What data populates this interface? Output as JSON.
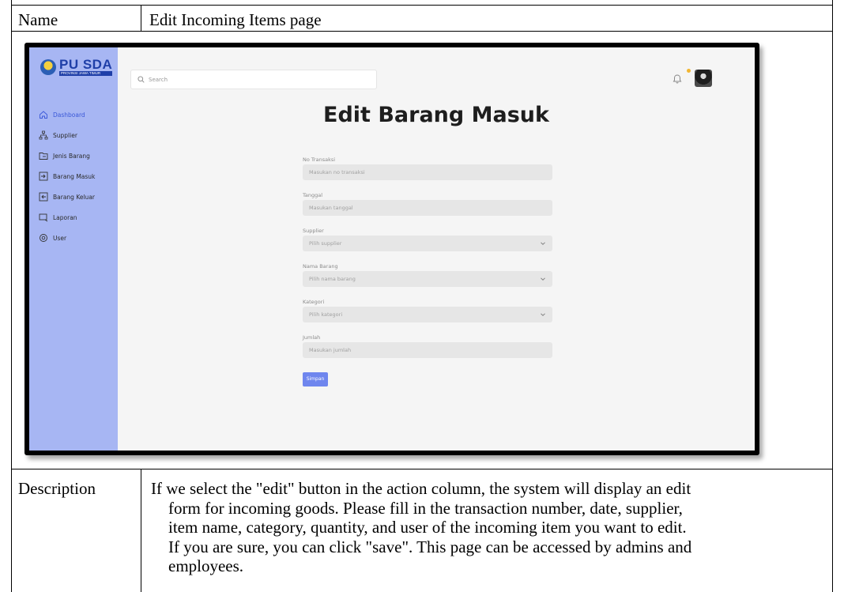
{
  "doc": {
    "name_label": "Name",
    "name_value": "Edit Incoming Items page",
    "description_label": "Description",
    "description_lines": [
      "If we select the \"edit\" button in the action column, the system will display an edit",
      "form for incoming goods. Please fill in the transaction number, date, supplier,",
      "item name, category, quantity, and user of the incoming item you want to edit.",
      "If you are sure, you can click \"save\". This page can be accessed by admins and",
      "employees."
    ]
  },
  "app": {
    "logo": {
      "main": "PU SDA",
      "sub": "PROVINSI JAWA TIMUR"
    },
    "sidebar": {
      "items": [
        {
          "label": "Dashboard",
          "icon": "home-icon",
          "active": true
        },
        {
          "label": "Supplier",
          "icon": "network-icon",
          "active": false
        },
        {
          "label": "Jenis Barang",
          "icon": "folder-icon",
          "active": false
        },
        {
          "label": "Barang Masuk",
          "icon": "inbox-in-icon",
          "active": false
        },
        {
          "label": "Barang Keluar",
          "icon": "inbox-out-icon",
          "active": false
        },
        {
          "label": "Laporan",
          "icon": "report-icon",
          "active": false
        },
        {
          "label": "User",
          "icon": "user-settings-icon",
          "active": false
        }
      ]
    },
    "search": {
      "placeholder": "Search"
    },
    "page_title": "Edit Barang Masuk",
    "form": {
      "fields": [
        {
          "label": "No Transaksi",
          "placeholder": "Masukan no transaksi",
          "type": "text"
        },
        {
          "label": "Tanggal",
          "placeholder": "Masukan tanggal",
          "type": "text"
        },
        {
          "label": "Supplier",
          "placeholder": "Pilih supplier",
          "type": "select"
        },
        {
          "label": "Nama Barang",
          "placeholder": "Pilih nama barang",
          "type": "select"
        },
        {
          "label": "Kategori",
          "placeholder": "Pilih kategori",
          "type": "select"
        },
        {
          "label": "Jumlah",
          "placeholder": "Masukan jumlah",
          "type": "text"
        }
      ],
      "submit_label": "Simpan"
    },
    "colors": {
      "sidebar": "#a7b6f3",
      "accent": "#3a58d8",
      "button": "#6f86ee",
      "notification_dot": "#f2b632"
    }
  }
}
